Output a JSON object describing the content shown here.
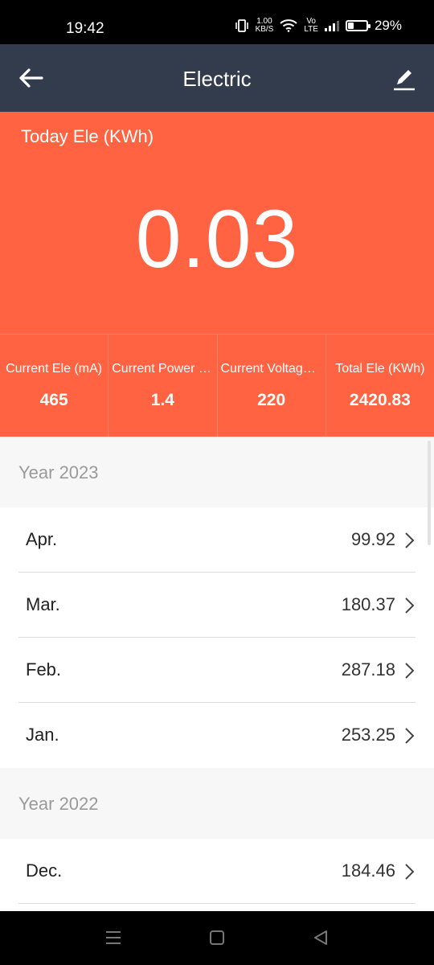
{
  "status_bar": {
    "time": "19:42",
    "net_speed_value": "1.00",
    "net_speed_unit": "KB/S",
    "volte_top": "Vo",
    "volte_bottom": "LTE",
    "battery": "29%"
  },
  "header": {
    "title": "Electric",
    "back_icon": "arrow-left-icon",
    "edit_icon": "pencil-icon"
  },
  "today": {
    "label": "Today Ele (KWh)",
    "value": "0.03"
  },
  "stats": [
    {
      "label": "Current Ele (mA)",
      "value": "465"
    },
    {
      "label": "Current Power (…",
      "value": "1.4"
    },
    {
      "label": "Current Voltage…",
      "value": "220"
    },
    {
      "label": "Total Ele (KWh)",
      "value": "2420.83"
    }
  ],
  "years": [
    {
      "label": "Year 2023",
      "months": [
        {
          "month": "Apr.",
          "value": "99.92"
        },
        {
          "month": "Mar.",
          "value": "180.37"
        },
        {
          "month": "Feb.",
          "value": "287.18"
        },
        {
          "month": "Jan.",
          "value": "253.25"
        }
      ]
    },
    {
      "label": "Year 2022",
      "months": [
        {
          "month": "Dec.",
          "value": "184.46"
        }
      ]
    }
  ],
  "colors": {
    "header_bg": "#323c4c",
    "accent": "#ff6341",
    "list_bg": "#ffffff",
    "section_bg": "#f7f7f7"
  }
}
